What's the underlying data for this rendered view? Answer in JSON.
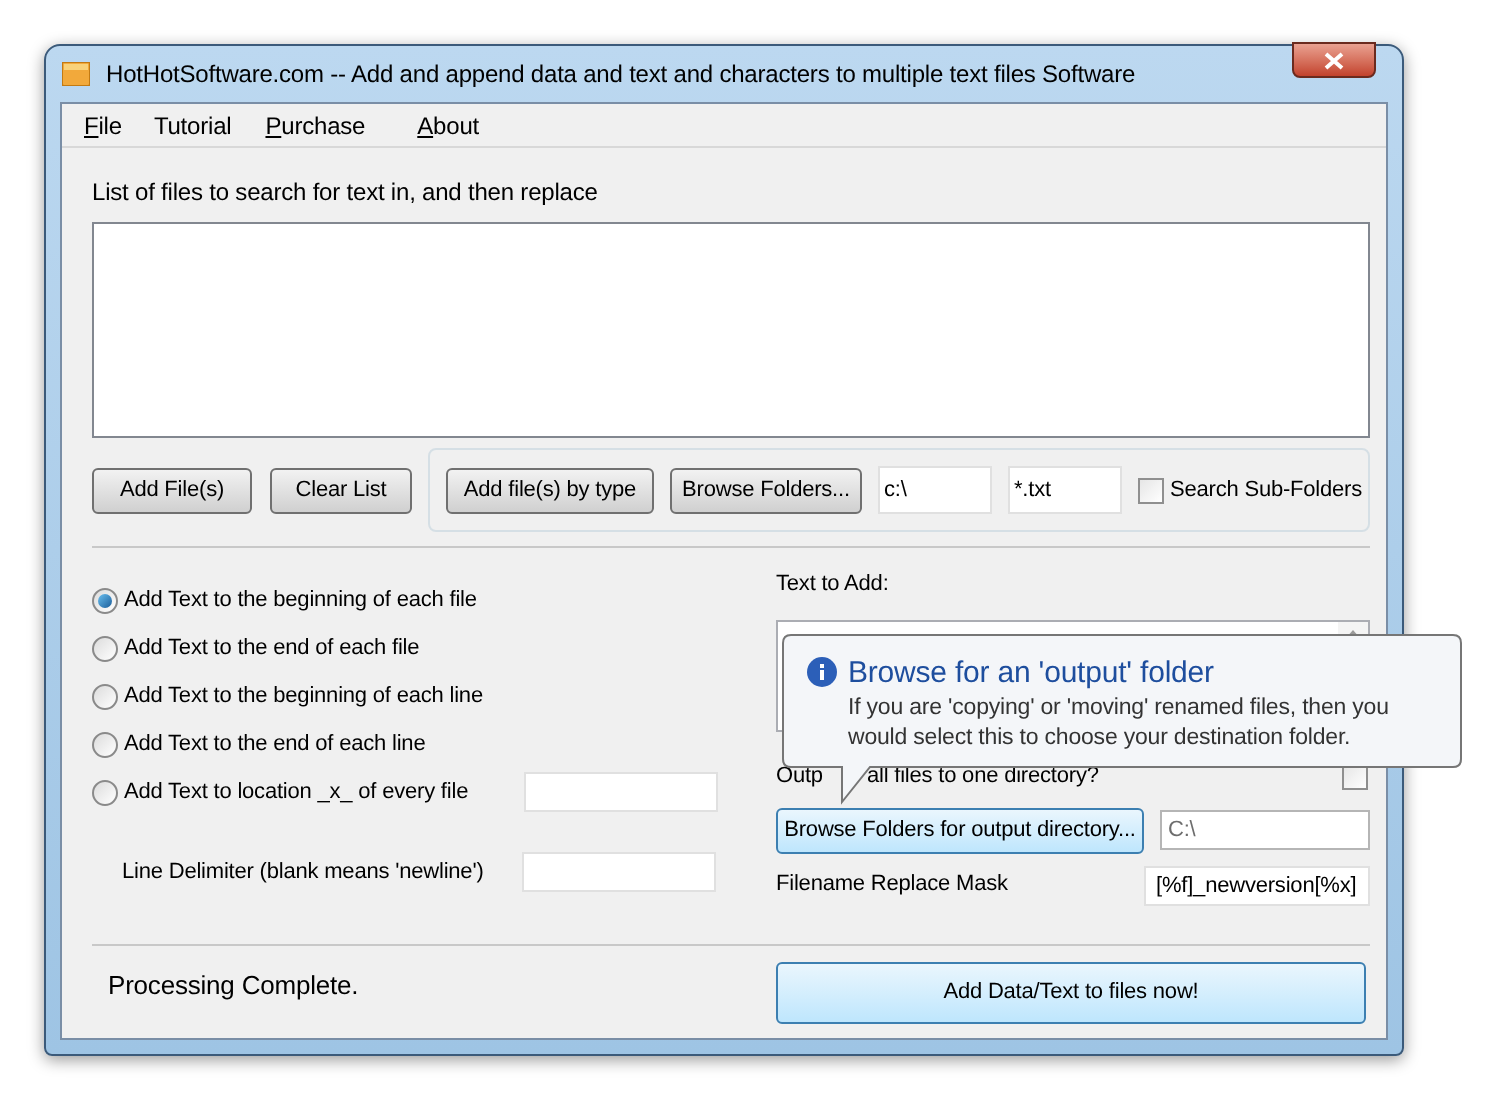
{
  "window": {
    "title": "HotHotSoftware.com -- Add and append data and text and characters to multiple text files Software"
  },
  "menu": [
    {
      "label": "File",
      "underlined": true
    },
    {
      "label": "Tutorial",
      "underlined": false
    },
    {
      "label": "Purchase",
      "underlined": true
    },
    {
      "label": "About",
      "underlined": true
    }
  ],
  "file_list": {
    "label": "List of files to search for text in, and then replace"
  },
  "file_buttons": [
    "Add File(s)",
    "Clear List"
  ],
  "type_group": {
    "add_by_type": "Add file(s) by type",
    "browse": "Browse Folders...",
    "folder_value": "c:\\",
    "mask_value": "*.txt",
    "subfolders": {
      "label": "Search Sub-Folders",
      "checked": false
    }
  },
  "modes": [
    {
      "kind": "radio",
      "label": "Add Text to the beginning of each file",
      "selected": true
    },
    {
      "kind": "radio",
      "label": "Add Text to the end of each file",
      "selected": false
    },
    {
      "kind": "radio",
      "label": "Add Text to the beginning of each line",
      "selected": false
    },
    {
      "kind": "radio",
      "label": "Add Text to the end of each line",
      "selected": false
    },
    {
      "kind": "radio_with_field",
      "label": "Add Text to location _x_ of every file",
      "selected": false
    }
  ],
  "delimiter": {
    "label": "Line Delimiter (blank means 'newline')"
  },
  "text_to_add": {
    "label": "Text to Add:"
  },
  "output": {
    "label_parts": [
      "Outp",
      "all files to one directory?"
    ],
    "checked": false,
    "browse": {
      "label": "Browse Folders for output directory...",
      "highlighted": true
    },
    "dir_value": "C:\\"
  },
  "mask": {
    "label": "Filename Replace Mask",
    "value": "[%f]_newversion[%x]"
  },
  "tooltip": {
    "title": "Browse for an 'output' folder",
    "body": "If you are 'copying' or 'moving' renamed files, then you would select this to choose your destination folder."
  },
  "status": "Processing Complete.",
  "run_button": {
    "label": "Add Data/Text to files now!",
    "highlighted": true
  }
}
